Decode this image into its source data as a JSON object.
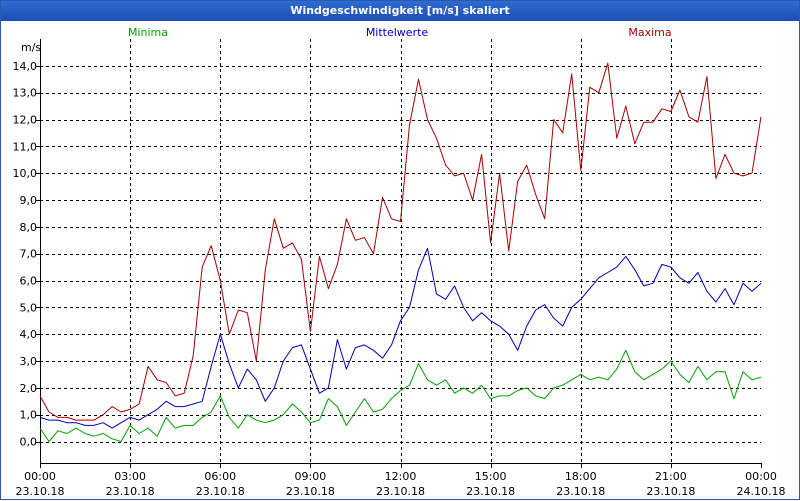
{
  "window": {
    "title": "Windgeschwindigkeit [m/s] skaliert"
  },
  "chart_data": {
    "type": "line",
    "title": "Windgeschwindigkeit [m/s] skaliert",
    "ylabel": "m/s",
    "xlabel": "",
    "ylim": [
      -0.8,
      15.0
    ],
    "yticks": [
      "0,0",
      "1,0",
      "2,0",
      "3,0",
      "4,0",
      "5,0",
      "6,0",
      "7,0",
      "8,0",
      "9,0",
      "10,0",
      "11,0",
      "12,0",
      "13,0",
      "14,0"
    ],
    "ytick_values": [
      0,
      1,
      2,
      3,
      4,
      5,
      6,
      7,
      8,
      9,
      10,
      11,
      12,
      13,
      14
    ],
    "xlim": [
      0,
      24
    ],
    "xtick_values": [
      0,
      3,
      6,
      9,
      12,
      15,
      18,
      21,
      24
    ],
    "xtick_times": [
      "00:00",
      "03:00",
      "06:00",
      "09:00",
      "12:00",
      "15:00",
      "18:00",
      "21:00",
      "00:00"
    ],
    "xtick_dates": [
      "23.10.18",
      "23.10.18",
      "23.10.18",
      "23.10.18",
      "23.10.18",
      "23.10.18",
      "23.10.18",
      "23.10.18",
      "24.10.18"
    ],
    "grid": true,
    "legend_position": "top",
    "series": [
      {
        "name": "Minima",
        "color": "#00a000",
        "x": [
          0,
          0.3,
          0.6,
          0.9,
          1.2,
          1.5,
          1.8,
          2.1,
          2.4,
          2.7,
          3.0,
          3.3,
          3.6,
          3.9,
          4.2,
          4.5,
          4.8,
          5.1,
          5.4,
          5.7,
          6.0,
          6.3,
          6.6,
          6.9,
          7.2,
          7.5,
          7.8,
          8.1,
          8.4,
          8.7,
          9.0,
          9.3,
          9.6,
          9.9,
          10.2,
          10.5,
          10.8,
          11.1,
          11.4,
          11.7,
          12.0,
          12.3,
          12.6,
          12.9,
          13.2,
          13.5,
          13.8,
          14.1,
          14.4,
          14.7,
          15.0,
          15.3,
          15.6,
          15.9,
          16.2,
          16.5,
          16.8,
          17.1,
          17.4,
          17.7,
          18.0,
          18.3,
          18.6,
          18.9,
          19.2,
          19.5,
          19.8,
          20.1,
          20.4,
          20.7,
          21.0,
          21.3,
          21.6,
          21.9,
          22.2,
          22.5,
          22.8,
          23.1,
          23.4,
          23.7,
          24.0
        ],
        "y": [
          0.5,
          0.0,
          0.4,
          0.3,
          0.5,
          0.3,
          0.2,
          0.3,
          0.1,
          0.0,
          0.6,
          0.3,
          0.5,
          0.2,
          0.9,
          0.5,
          0.6,
          0.6,
          0.9,
          1.1,
          1.7,
          0.9,
          0.5,
          1.0,
          0.8,
          0.7,
          0.8,
          1.0,
          1.4,
          1.1,
          0.7,
          0.8,
          1.6,
          1.3,
          0.6,
          1.1,
          1.6,
          1.1,
          1.2,
          1.6,
          1.9,
          2.1,
          2.9,
          2.3,
          2.1,
          2.3,
          1.8,
          2.0,
          1.8,
          2.1,
          1.6,
          1.7,
          1.7,
          1.9,
          2.0,
          1.7,
          1.6,
          2.0,
          2.1,
          2.3,
          2.5,
          2.3,
          2.4,
          2.3,
          2.7,
          3.4,
          2.6,
          2.3,
          2.5,
          2.7,
          3.0,
          2.5,
          2.2,
          2.8,
          2.3,
          2.6,
          2.6,
          1.6,
          2.6,
          2.3,
          2.4
        ]
      },
      {
        "name": "Mittelwerte",
        "color": "#0000b8",
        "x": [
          0,
          0.3,
          0.6,
          0.9,
          1.2,
          1.5,
          1.8,
          2.1,
          2.4,
          2.7,
          3.0,
          3.3,
          3.6,
          3.9,
          4.2,
          4.5,
          4.8,
          5.1,
          5.4,
          5.7,
          6.0,
          6.3,
          6.6,
          6.9,
          7.2,
          7.5,
          7.8,
          8.1,
          8.4,
          8.7,
          9.0,
          9.3,
          9.6,
          9.9,
          10.2,
          10.5,
          10.8,
          11.1,
          11.4,
          11.7,
          12.0,
          12.3,
          12.6,
          12.9,
          13.2,
          13.5,
          13.8,
          14.1,
          14.4,
          14.7,
          15.0,
          15.3,
          15.6,
          15.9,
          16.2,
          16.5,
          16.8,
          17.1,
          17.4,
          17.7,
          18.0,
          18.3,
          18.6,
          18.9,
          19.2,
          19.5,
          19.8,
          20.1,
          20.4,
          20.7,
          21.0,
          21.3,
          21.6,
          21.9,
          22.2,
          22.5,
          22.8,
          23.1,
          23.4,
          23.7,
          24.0
        ],
        "y": [
          0.9,
          0.8,
          0.8,
          0.7,
          0.7,
          0.6,
          0.6,
          0.7,
          0.5,
          0.7,
          0.9,
          0.8,
          1.0,
          1.2,
          1.5,
          1.3,
          1.3,
          1.4,
          1.5,
          2.8,
          4.0,
          2.9,
          2.0,
          2.7,
          2.3,
          1.5,
          2.0,
          3.0,
          3.5,
          3.6,
          2.7,
          1.8,
          2.0,
          3.8,
          2.7,
          3.5,
          3.6,
          3.4,
          3.1,
          3.6,
          4.5,
          5.0,
          6.4,
          7.2,
          5.5,
          5.3,
          5.8,
          5.0,
          4.5,
          4.8,
          4.5,
          4.3,
          4.0,
          3.4,
          4.3,
          4.9,
          5.1,
          4.6,
          4.3,
          5.0,
          5.3,
          5.7,
          6.1,
          6.3,
          6.5,
          6.9,
          6.4,
          5.8,
          5.9,
          6.6,
          6.5,
          6.1,
          5.9,
          6.3,
          5.6,
          5.2,
          5.7,
          5.1,
          5.9,
          5.6,
          5.9
        ]
      },
      {
        "name": "Maxima",
        "color": "#a80000",
        "x": [
          0,
          0.3,
          0.6,
          0.9,
          1.2,
          1.5,
          1.8,
          2.1,
          2.4,
          2.7,
          3.0,
          3.3,
          3.6,
          3.9,
          4.2,
          4.5,
          4.8,
          5.1,
          5.4,
          5.7,
          6.0,
          6.3,
          6.6,
          6.9,
          7.2,
          7.5,
          7.8,
          8.1,
          8.4,
          8.7,
          9.0,
          9.3,
          9.6,
          9.9,
          10.2,
          10.5,
          10.8,
          11.1,
          11.4,
          11.7,
          12.0,
          12.3,
          12.6,
          12.9,
          13.2,
          13.5,
          13.8,
          14.1,
          14.4,
          14.7,
          15.0,
          15.3,
          15.6,
          15.9,
          16.2,
          16.5,
          16.8,
          17.1,
          17.4,
          17.7,
          18.0,
          18.3,
          18.6,
          18.9,
          19.2,
          19.5,
          19.8,
          20.1,
          20.4,
          20.7,
          21.0,
          21.3,
          21.6,
          21.9,
          22.2,
          22.5,
          22.8,
          23.1,
          23.4,
          23.7,
          24.0
        ],
        "y": [
          1.7,
          1.1,
          0.9,
          0.9,
          0.8,
          0.8,
          0.8,
          1.0,
          1.3,
          1.1,
          1.2,
          1.4,
          2.8,
          2.3,
          2.2,
          1.7,
          1.8,
          3.2,
          6.5,
          7.3,
          6.0,
          4.0,
          4.9,
          4.8,
          3.0,
          6.4,
          8.3,
          7.2,
          7.4,
          6.8,
          4.1,
          6.9,
          5.7,
          6.6,
          8.3,
          7.5,
          7.6,
          7.0,
          9.1,
          8.3,
          8.2,
          11.8,
          13.5,
          12.0,
          11.3,
          10.3,
          9.9,
          10.0,
          9.0,
          10.7,
          7.4,
          10.0,
          7.1,
          9.7,
          10.3,
          9.2,
          8.3,
          12.0,
          11.5,
          13.7,
          10.1,
          13.2,
          13.0,
          14.1,
          11.3,
          12.5,
          11.1,
          11.9,
          11.9,
          12.4,
          12.3,
          13.1,
          12.1,
          11.9,
          13.6,
          9.8,
          10.7,
          10.0,
          9.9,
          10.0,
          12.1
        ]
      }
    ]
  }
}
